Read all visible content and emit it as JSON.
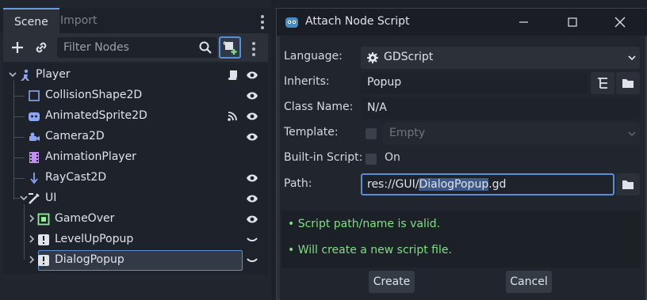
{
  "scene_dock": {
    "tabs": [
      {
        "label": "Scene"
      },
      {
        "label": "Import"
      }
    ],
    "filter": {
      "placeholder": "Filter Nodes",
      "value": ""
    },
    "nodes": [
      {
        "name": "Player",
        "icon": "character-body-icon"
      },
      {
        "name": "CollisionShape2D",
        "icon": "collision-shape-icon"
      },
      {
        "name": "AnimatedSprite2D",
        "icon": "animated-sprite-icon"
      },
      {
        "name": "Camera2D",
        "icon": "camera-icon"
      },
      {
        "name": "AnimationPlayer",
        "icon": "animation-player-icon"
      },
      {
        "name": "RayCast2D",
        "icon": "raycast-icon"
      },
      {
        "name": "UI",
        "icon": "control-icon"
      },
      {
        "name": "GameOver",
        "icon": "texture-rect-icon"
      },
      {
        "name": "LevelUpPopup",
        "icon": "warning-icon"
      },
      {
        "name": "DialogPopup",
        "icon": "warning-icon"
      }
    ]
  },
  "dialog": {
    "title": "Attach Node Script",
    "fields": {
      "language": {
        "label": "Language:",
        "value": "GDScript"
      },
      "inherits": {
        "label": "Inherits:",
        "value": "Popup"
      },
      "class_name": {
        "label": "Class Name:",
        "value": "N/A"
      },
      "template": {
        "label": "Template:",
        "value": "Empty"
      },
      "builtin": {
        "label": "Built-in Script:",
        "value": "On"
      },
      "path": {
        "label": "Path:",
        "prefix": "res://GUI/",
        "highlight": "DialogPopup",
        "suffix": ".gd"
      }
    },
    "messages": [
      "Script path/name is valid.",
      "Will create a new script file."
    ],
    "bullet": "•",
    "buttons": {
      "create": "Create",
      "cancel": "Cancel"
    }
  },
  "colors": {
    "accent": "#5a8fd6",
    "valid_text": "#7ee083",
    "panel": "#21252d"
  }
}
